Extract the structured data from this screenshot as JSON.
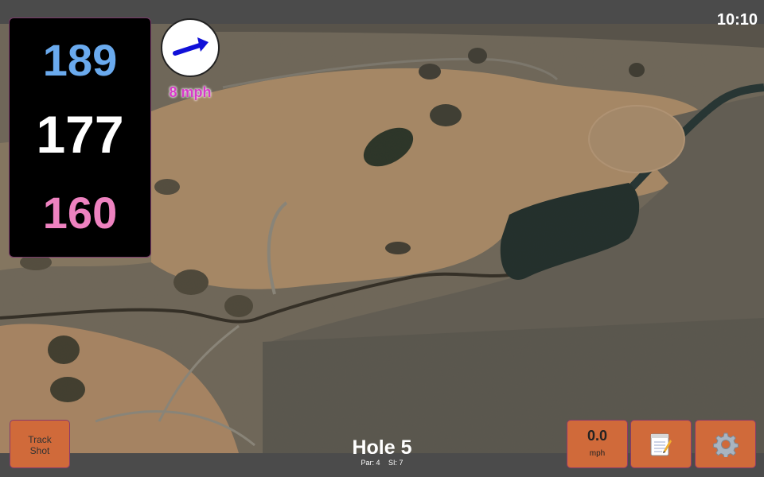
{
  "status_bar": {
    "time": "10:10"
  },
  "distances": {
    "back": "189",
    "middle": "177",
    "front": "160"
  },
  "wind": {
    "speed": "8 mph",
    "direction_icon": "arrow-icon"
  },
  "buttons": {
    "track_shot_line1": "Track",
    "track_shot_line2": "Shot",
    "speed_value": "0.0",
    "speed_unit": "mph",
    "notes_icon": "notepad-icon",
    "settings_icon": "gear-icon"
  },
  "hole": {
    "title": "Hole 5",
    "par": "Par: 4",
    "si": "SI: 7"
  },
  "colors": {
    "back_distance": "#6aaaee",
    "middle_distance": "#ffffff",
    "front_distance": "#ee82c0",
    "button_bg": "#d06a3a",
    "wind_text": "#d83ac8"
  }
}
